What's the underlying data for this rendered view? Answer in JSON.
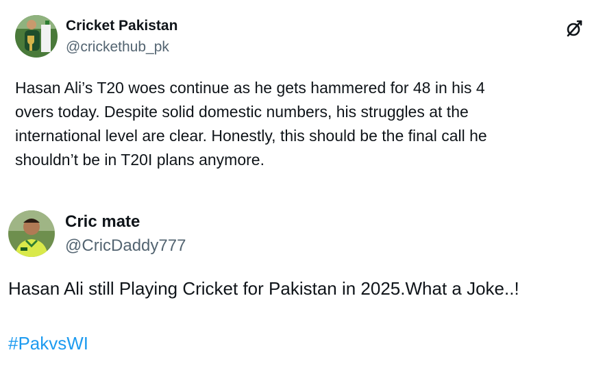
{
  "posts": [
    {
      "author": {
        "display_name": "Cricket Pakistan",
        "handle": "@crickethub_pk",
        "avatar_icon": "trophy-avatar-icon"
      },
      "text_lines": [
        "Hasan Ali’s T20 woes continue as he gets hammered for 48 in his 4",
        "overs today. Despite solid domestic numbers, his struggles at the",
        "international level are clear. Honestly, this should be the final call he",
        "shouldn’t be in T20I plans anymore."
      ],
      "brand_icon": "x-logo-icon"
    },
    {
      "author": {
        "display_name": "Cric mate",
        "handle": "@CricDaddy777",
        "avatar_icon": "cricketer-avatar-icon"
      },
      "text": "Hasan Ali still Playing Cricket for Pakistan in 2025.What a Joke..!",
      "hashtag": "#PakvsWI"
    }
  ],
  "colors": {
    "text": "#0f1419",
    "secondary_text": "#536471",
    "link": "#1d9bf0",
    "background": "#ffffff"
  }
}
